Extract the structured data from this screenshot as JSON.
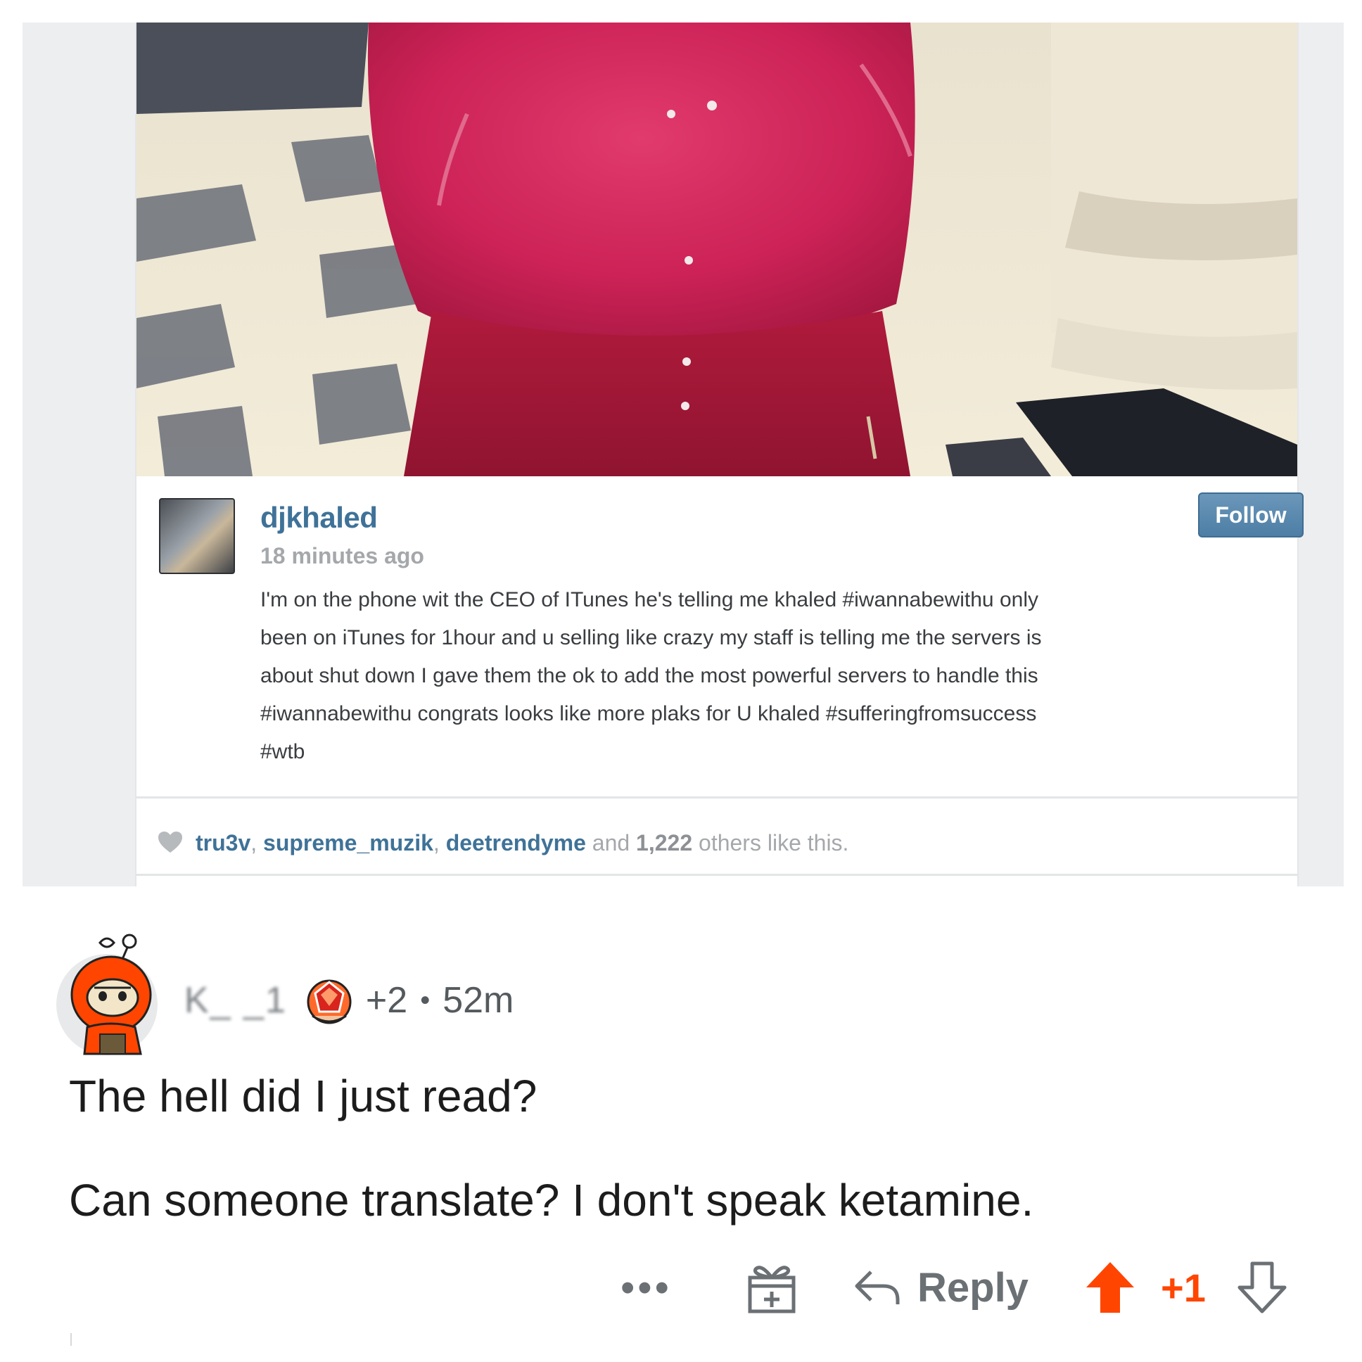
{
  "post": {
    "username": "djkhaled",
    "time": "18 minutes ago",
    "follow_label": "Follow",
    "caption_lines": [
      "I'm on the phone wit the CEO of ITunes he's telling me khaled #iwannabewithu only",
      "been on iTunes for 1hour and u selling like crazy my staff is telling me the servers is",
      "about shut down I gave them the ok to add the most powerful servers to handle this",
      "#iwannabewithu congrats looks like more plaks for U khaled #sufferingfromsuccess",
      "#wtb"
    ],
    "likes": {
      "users": [
        "tru3v",
        "supreme_muzik",
        "deetrendyme"
      ],
      "separator": ",",
      "and_label": "and",
      "count": "1,222",
      "suffix": "others like this."
    }
  },
  "comment": {
    "username": "K_ _1",
    "karma": "+2",
    "dot": "•",
    "time": "52m",
    "body": [
      "The hell did I just read?",
      "Can someone translate? I don't speak ketamine."
    ],
    "actions": {
      "more_label": "•••",
      "reply_label": "Reply",
      "score": "+1"
    }
  },
  "colors": {
    "upvote": "#ff4500",
    "link_blue": "#3f7298",
    "follow_blue": "#4d7ea5"
  }
}
